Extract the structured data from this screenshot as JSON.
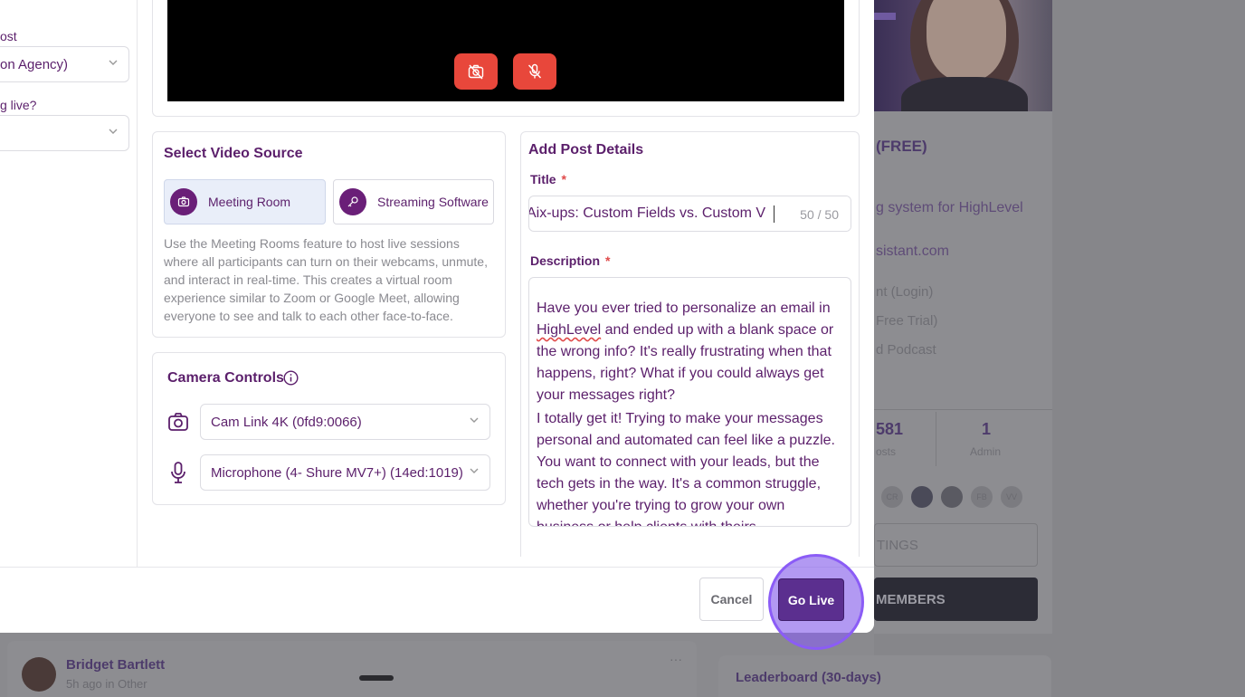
{
  "background": {
    "course_title_partial": "(FREE)",
    "course_desc_partial": "g system for HighLevel",
    "site_partial": "sistant.com",
    "links": [
      "nt (Login)",
      "Free Trial)",
      "d Podcast"
    ],
    "stats": [
      {
        "value": "581",
        "label": "osts"
      },
      {
        "value": "1",
        "label": "Admin"
      }
    ],
    "avatars": [
      "CR",
      "FB",
      "VV"
    ],
    "settings_label": "TINGS",
    "members_label": "MEMBERS",
    "post_author": "Bridget Bartlett",
    "post_meta": "5h ago in Other",
    "post_more": "···",
    "leaderboard_title": "Leaderboard (30-days)"
  },
  "left_panel": {
    "label_1": "ost",
    "select_1": "on Agency)",
    "label_2": "g live?",
    "select_2": ""
  },
  "video_controls": {
    "camera_off_icon": "camera-off-icon",
    "mic_off_icon": "mic-off-icon",
    "button_color": "#e8473b"
  },
  "video_source": {
    "title": "Select Video Source",
    "options": [
      {
        "label": "Meeting Room",
        "icon": "camera-icon",
        "selected": true
      },
      {
        "label": "Streaming Software",
        "icon": "key-icon",
        "selected": false
      }
    ],
    "description": "Use the Meeting Rooms feature to host live sessions where all participants can turn on their webcams, unmute, and interact in real-time. This creates a virtual room experience similar to Zoom or Google Meet, allowing everyone to see and talk to each other face-to-face."
  },
  "camera_controls": {
    "title": "Camera Controls",
    "camera_value": "Cam Link 4K (0fd9:0066)",
    "microphone_value": "Microphone (4- Shure MV7+) (14ed:1019)"
  },
  "post_details": {
    "title": "Add Post Details",
    "title_label": "Title",
    "required_mark": "*",
    "title_value": "Aix-ups: Custom Fields vs. Custom V",
    "title_counter": "50 / 50",
    "description_label": "Description",
    "description_p1_a": "Have you ever tried to personalize an email in ",
    "description_p1_b": "HighLevel",
    "description_p1_c": " and ended up with a blank space or the wrong info? It's really frustrating when that happens, right? What if you could always get your messages right?",
    "description_p2": "I totally get it! Trying to make your messages personal and automated can feel like a puzzle. You want to connect with your leads, but the tech gets in the way. It's a common struggle, whether you're trying to grow your own business or help clients with theirs."
  },
  "footer": {
    "cancel_label": "Cancel",
    "golive_label": "Go Live"
  },
  "colors": {
    "brand_purple": "#5b1f6b",
    "primary_button": "#5b2f8f",
    "highlight_ring": "#8b5cf6",
    "danger": "#e8473b"
  }
}
